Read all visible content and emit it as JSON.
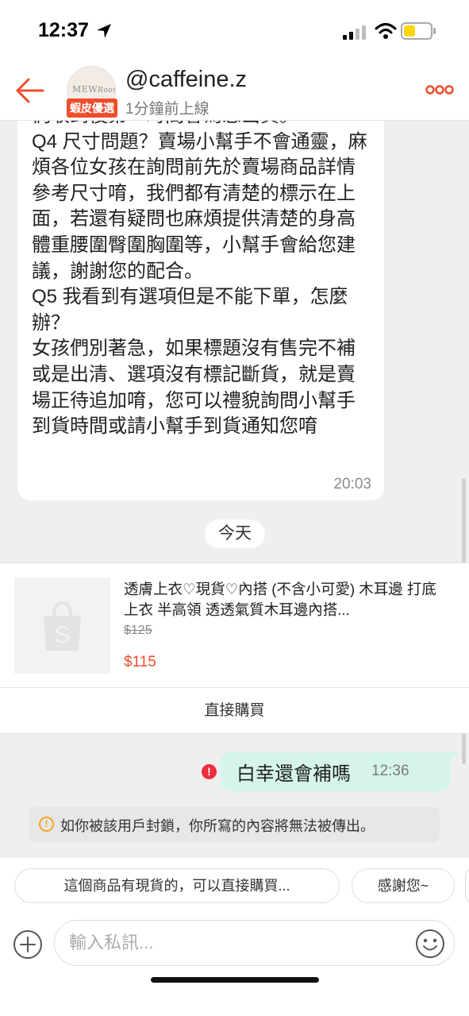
{
  "status_bar": {
    "time": "12:37"
  },
  "header": {
    "username": "@caffeine.z",
    "online_status": "1分鐘前上線",
    "badge": "蝦皮優選",
    "avatar_text_1": "MEW",
    "avatar_text_2": "Room"
  },
  "messages": {
    "incoming_text": "們收到後第一時間會為您出貨。\nQ4 尺寸問題？賣場小幫手不會通靈，麻煩各位女孩在詢問前先於賣場商品詳情參考尺寸唷，我們都有清楚的標示在上面，若還有疑問也麻煩提供清楚的身高體重腰圍臀圍胸圍等，小幫手會給您建議，謝謝您的配合。\nQ5 我看到有選項但是不能下單，怎麼辦？\n女孩們別著急，如果標題沒有售完不補或是出清、選項沒有標記斷貨，就是賣場正待追加唷，您可以禮貌詢問小幫手到貨時間或請小幫手到貨通知您唷",
    "incoming_time": "20:03",
    "date_divider": "今天",
    "outgoing_text": "白幸還會補嗎",
    "outgoing_time": "12:36",
    "notice": "如你被該用戶封鎖，你所寫的內容將無法被傳出。"
  },
  "product": {
    "title": "透膚上衣♡現貨♡內搭 (不含小可愛) 木耳邊 打底上衣 半高領 透透氣質木耳邊內搭...",
    "original_price": "$125",
    "price": "$115",
    "buy_label": "直接購買"
  },
  "quick_replies": [
    "這個商品有現貨的，可以直接購買...",
    "感謝您~"
  ],
  "input": {
    "placeholder": "輸入私訊..."
  },
  "colors": {
    "brand": "#ee4d2d",
    "outgoing_bubble": "#d5f4ec",
    "error": "#ee2c3c",
    "notice_icon": "#f5a623"
  }
}
